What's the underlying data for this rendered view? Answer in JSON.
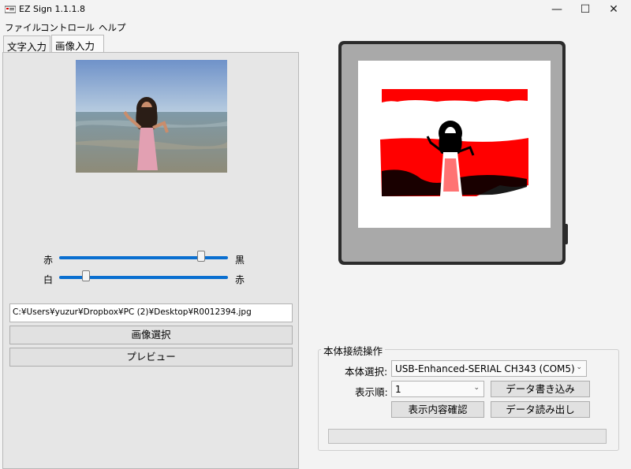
{
  "window": {
    "title": "EZ Sign 1.1.1.8",
    "minimize_glyph": "—",
    "maximize_glyph": "☐",
    "close_glyph": "✕"
  },
  "menu": [
    "ファイル",
    "コントロール",
    "ヘルプ"
  ],
  "tabs": [
    {
      "label": "文字入力",
      "active": false
    },
    {
      "label": "画像入力",
      "active": true
    }
  ],
  "image_panel": {
    "slider1": {
      "left_label": "赤",
      "right_label": "黒",
      "value": 0.84
    },
    "slider2": {
      "left_label": "白",
      "right_label": "赤",
      "value": 0.16
    },
    "file_path": "C:¥Users¥yuzur¥Dropbox¥PC (2)¥Desktop¥R0012394.jpg",
    "select_image_button": "画像選択",
    "preview_button": "プレビュー"
  },
  "connection": {
    "group_title": "本体接続操作",
    "device_label": "本体選択:",
    "device_value": "USB-Enhanced-SERIAL CH343 (COM5)",
    "order_label": "表示順:",
    "order_value": "1",
    "write_button": "データ書き込み",
    "confirm_button": "表示内容確認",
    "read_button": "データ読み出し",
    "progress": 0
  },
  "colors": {
    "slider_accent": "#0a6fd0",
    "device_frame": "#2b2b2b",
    "preview_red": "#ff0000"
  }
}
